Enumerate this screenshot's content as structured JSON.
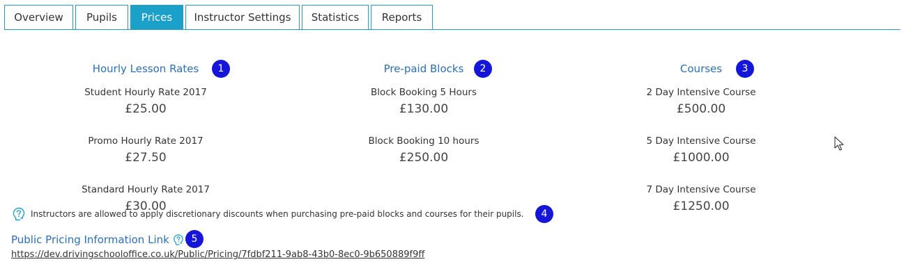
{
  "tabs": [
    {
      "label": "Overview",
      "active": false
    },
    {
      "label": "Pupils",
      "active": false
    },
    {
      "label": "Prices",
      "active": true
    },
    {
      "label": "Instructor Settings",
      "active": false
    },
    {
      "label": "Statistics",
      "active": false
    },
    {
      "label": "Reports",
      "active": false
    }
  ],
  "columns": {
    "hourly": {
      "title": "Hourly Lesson Rates",
      "marker": "1",
      "items": [
        {
          "name": "Student Hourly Rate 2017",
          "price": "£25.00"
        },
        {
          "name": "Promo Hourly Rate 2017",
          "price": "£27.50"
        },
        {
          "name": "Standard Hourly Rate 2017",
          "price": "£30.00"
        }
      ]
    },
    "blocks": {
      "title": "Pre-paid Blocks",
      "marker": "2",
      "items": [
        {
          "name": "Block Booking 5 Hours",
          "price": "£130.00"
        },
        {
          "name": "Block Booking 10 hours",
          "price": "£250.00"
        }
      ]
    },
    "courses": {
      "title": "Courses",
      "marker": "3",
      "items": [
        {
          "name": "2 Day Intensive Course",
          "price": "£500.00"
        },
        {
          "name": "5 Day Intensive Course",
          "price": "£1000.00"
        },
        {
          "name": "7 Day Intensive Course",
          "price": "£1250.00"
        }
      ]
    }
  },
  "info": {
    "text": "Instructors are allowed to apply discretionary discounts when purchasing pre-paid blocks and courses for their pupils.",
    "marker": "4",
    "icon": "help-icon"
  },
  "public_link": {
    "title": "Public Pricing Information Link",
    "marker": "5",
    "url": "https://dev.drivingschooloffice.co.uk/Public/Pricing/7fdbf211-9ab8-43b0-8ec0-9b650889f9ff",
    "icon": "help-icon"
  },
  "colors": {
    "accent": "#1aa0c9",
    "link": "#2a6fba",
    "marker": "#1616d8"
  }
}
